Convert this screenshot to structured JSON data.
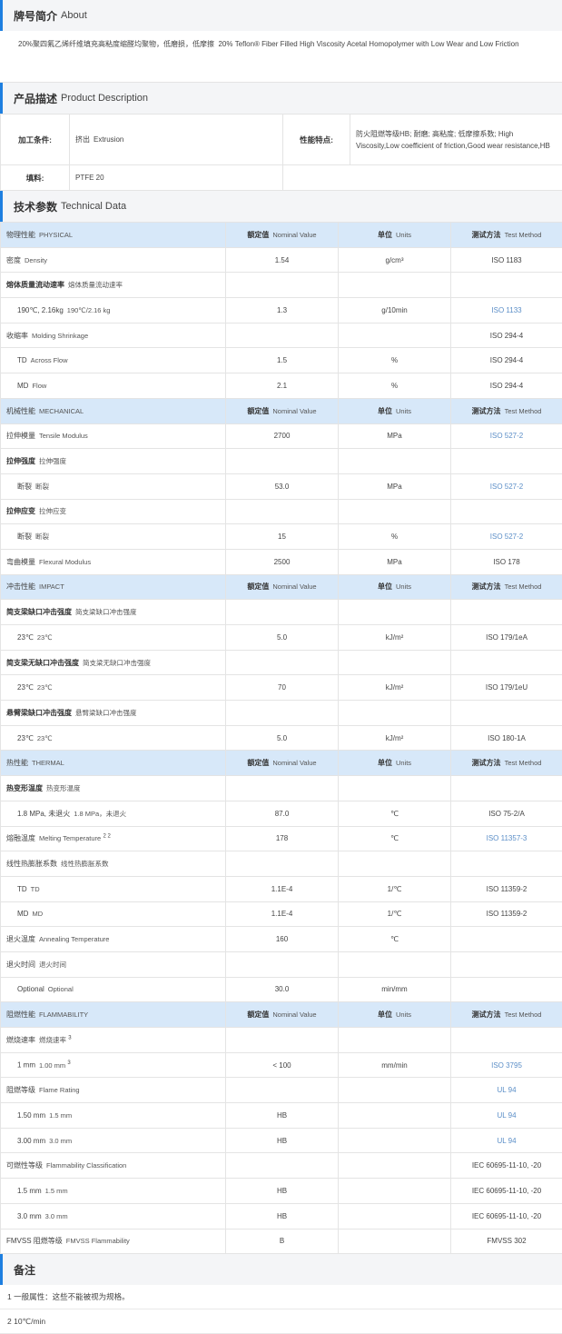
{
  "about": {
    "title_cn": "牌号简介",
    "title_en": "About",
    "text_cn": "20%聚四氟乙烯纤维填充高粘度缩醛均聚物，低磨损，低摩擦",
    "text_en": "20% Teflon® Fiber Filled High Viscosity Acetal Homopolymer with Low Wear and Low Friction"
  },
  "product": {
    "title_cn": "产品描述",
    "title_en": "Product Description",
    "processing_label": "加工条件:",
    "processing_value_cn": "挤出",
    "processing_value_en": "Extrusion",
    "features_label": "性能特点:",
    "features_value": "防火阻燃等级HB; 耐磨; 高粘度; 低摩擦系数;  High Viscosity,Low coefficient of friction,Good wear resistance,HB",
    "filler_label": "填料:",
    "filler_value": "PTFE 20"
  },
  "technical": {
    "title_cn": "技术参数",
    "title_en": "Technical Data",
    "header": {
      "nominal_cn": "额定值",
      "nominal_en": "Nominal Value",
      "units_cn": "单位",
      "units_en": "Units",
      "method_cn": "测试方法",
      "method_en": "Test Method"
    },
    "rows": [
      {
        "type": "hdr",
        "cn": "物理性能",
        "en": "PHYSICAL"
      },
      {
        "type": "row",
        "cn": "密度",
        "en": "Density",
        "value": "1.54",
        "unit": "g/cm³",
        "method": "ISO 1183"
      },
      {
        "type": "row",
        "cn": "熔体质量流动速率",
        "en": "熔体质量流动速率",
        "bold": true,
        "value": "",
        "unit": "",
        "method": ""
      },
      {
        "type": "row",
        "sub": true,
        "cn": "190℃, 2.16kg",
        "en": "190℃/2.16 kg",
        "value": "1.3",
        "unit": "g/10min",
        "method": "ISO 1133",
        "link": true
      },
      {
        "type": "row",
        "cn": "收缩率",
        "en": "Molding Shrinkage",
        "value": "",
        "unit": "",
        "method": "ISO 294-4"
      },
      {
        "type": "row",
        "sub": true,
        "cn": "TD",
        "en": "Across Flow",
        "value": "1.5",
        "unit": "%",
        "method": "ISO 294-4"
      },
      {
        "type": "row",
        "sub": true,
        "cn": "MD",
        "en": "Flow",
        "value": "2.1",
        "unit": "%",
        "method": "ISO 294-4"
      },
      {
        "type": "hdr",
        "cn": "机械性能",
        "en": "MECHANICAL"
      },
      {
        "type": "row",
        "cn": "拉伸模量",
        "en": "Tensile Modulus",
        "value": "2700",
        "unit": "MPa",
        "method": "ISO 527-2",
        "link": true
      },
      {
        "type": "row",
        "cn": "拉伸强度",
        "en": "拉伸强度",
        "bold": true,
        "value": "",
        "unit": "",
        "method": ""
      },
      {
        "type": "row",
        "sub": true,
        "cn": "断裂",
        "en": "断裂",
        "value": "53.0",
        "unit": "MPa",
        "method": "ISO 527-2",
        "link": true
      },
      {
        "type": "row",
        "cn": "拉伸应变",
        "en": "拉伸应变",
        "bold": true,
        "value": "",
        "unit": "",
        "method": ""
      },
      {
        "type": "row",
        "sub": true,
        "cn": "断裂",
        "en": "断裂",
        "value": "15",
        "unit": "%",
        "method": "ISO 527-2",
        "link": true
      },
      {
        "type": "row",
        "cn": "弯曲模量",
        "en": "Flexural Modulus",
        "value": "2500",
        "unit": "MPa",
        "method": "ISO 178"
      },
      {
        "type": "hdr",
        "cn": "冲击性能",
        "en": "IMPACT"
      },
      {
        "type": "row",
        "cn": "简支梁缺口冲击强度",
        "en": "简支梁缺口冲击强度",
        "bold": true,
        "value": "",
        "unit": "",
        "method": ""
      },
      {
        "type": "row",
        "sub": true,
        "cn": "23℃",
        "en": "23℃",
        "value": "5.0",
        "unit": "kJ/m²",
        "method": "ISO 179/1eA"
      },
      {
        "type": "row",
        "cn": "简支梁无缺口冲击强度",
        "en": "简支梁无缺口冲击强度",
        "bold": true,
        "value": "",
        "unit": "",
        "method": ""
      },
      {
        "type": "row",
        "sub": true,
        "cn": "23℃",
        "en": "23℃",
        "value": "70",
        "unit": "kJ/m²",
        "method": "ISO 179/1eU"
      },
      {
        "type": "row",
        "cn": "悬臂梁缺口冲击强度",
        "en": "悬臂梁缺口冲击强度",
        "bold": true,
        "value": "",
        "unit": "",
        "method": ""
      },
      {
        "type": "row",
        "sub": true,
        "cn": "23℃",
        "en": "23℃",
        "value": "5.0",
        "unit": "kJ/m²",
        "method": "ISO 180-1A"
      },
      {
        "type": "hdr",
        "cn": "热性能",
        "en": "THERMAL"
      },
      {
        "type": "row",
        "cn": "热变形温度",
        "en": "热变形温度",
        "bold": true,
        "value": "",
        "unit": "",
        "method": ""
      },
      {
        "type": "row",
        "sub": true,
        "cn": "1.8 MPa, 未退火",
        "en": "1.8 MPa，未退火",
        "value": "87.0",
        "unit": "℃",
        "method": "ISO 75-2/A"
      },
      {
        "type": "row",
        "cn": "熔融温度",
        "en": "Melting Temperature",
        "sup": "2 2",
        "value": "178",
        "unit": "℃",
        "method": "ISO 11357-3",
        "link": true
      },
      {
        "type": "row",
        "cn": "线性热膨胀系数",
        "en": "线性热膨胀系数",
        "value": "",
        "unit": "",
        "method": ""
      },
      {
        "type": "row",
        "sub": true,
        "cn": "TD",
        "en": "TD",
        "value": "1.1E-4",
        "unit": "1/℃",
        "method": "ISO 11359-2"
      },
      {
        "type": "row",
        "sub": true,
        "cn": "MD",
        "en": "MD",
        "value": "1.1E-4",
        "unit": "1/℃",
        "method": "ISO 11359-2"
      },
      {
        "type": "row",
        "cn": "退火温度",
        "en": "Annealing Temperature",
        "value": "160",
        "unit": "℃",
        "method": ""
      },
      {
        "type": "row",
        "cn": "退火时间",
        "en": "退火时间",
        "value": "",
        "unit": "",
        "method": ""
      },
      {
        "type": "row",
        "sub": true,
        "cn": "Optional",
        "en": "Optional",
        "value": "30.0",
        "unit": "min/mm",
        "method": ""
      },
      {
        "type": "hdr",
        "cn": "阻燃性能",
        "en": "FLAMMABILITY"
      },
      {
        "type": "row",
        "cn": "燃烧速率",
        "en": "燃烧速率",
        "sup": "3",
        "value": "",
        "unit": "",
        "method": ""
      },
      {
        "type": "row",
        "sub": true,
        "cn": "1 mm",
        "en": "1.00 mm",
        "sup": "3",
        "value": "< 100",
        "unit": "mm/min",
        "method": "ISO 3795",
        "link": true
      },
      {
        "type": "row",
        "cn": "阻燃等级",
        "en": "Flame Rating",
        "value": "",
        "unit": "",
        "method": "UL 94",
        "link": true
      },
      {
        "type": "row",
        "sub": true,
        "cn": "1.50 mm",
        "en": "1.5 mm",
        "value": "HB",
        "unit": "",
        "method": "UL 94",
        "link": true
      },
      {
        "type": "row",
        "sub": true,
        "cn": "3.00 mm",
        "en": "3.0 mm",
        "value": "HB",
        "unit": "",
        "method": "UL 94",
        "link": true
      },
      {
        "type": "row",
        "cn": "可燃性等级",
        "en": "Flammability Classification",
        "value": "",
        "unit": "",
        "method": "IEC 60695-11-10, -20"
      },
      {
        "type": "row",
        "sub": true,
        "cn": "1.5 mm",
        "en": "1.5 mm",
        "value": "HB",
        "unit": "",
        "method": "IEC 60695-11-10, -20"
      },
      {
        "type": "row",
        "sub": true,
        "cn": "3.0 mm",
        "en": "3.0 mm",
        "value": "HB",
        "unit": "",
        "method": "IEC 60695-11-10, -20"
      },
      {
        "type": "row",
        "cn": "FMVSS 阻燃等级",
        "en": "FMVSS Flammability",
        "value": "B",
        "unit": "",
        "method": "FMVSS 302"
      }
    ]
  },
  "notes": {
    "title": "备注",
    "lines": [
      "1 一般属性：这些不能被视为规格。",
      "2 10℃/min"
    ]
  }
}
